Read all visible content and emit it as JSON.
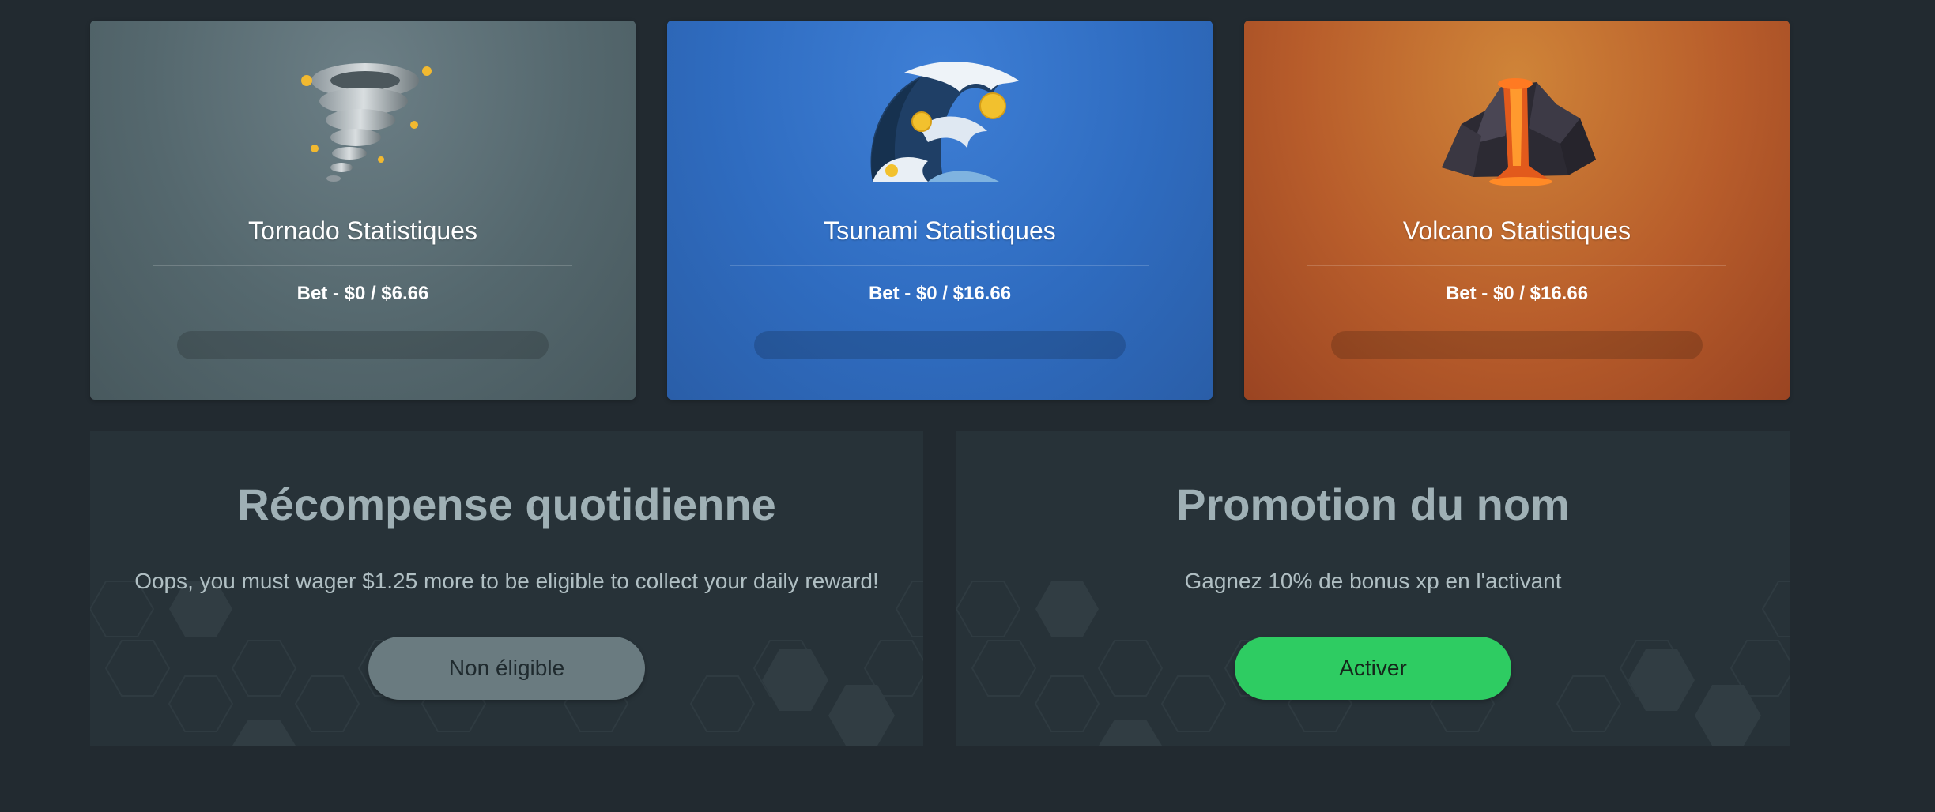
{
  "stat_cards": [
    {
      "id": "tornado",
      "title": "Tornado Statistiques",
      "bet": "Bet - $0 / $6.66",
      "progress": 0
    },
    {
      "id": "tsunami",
      "title": "Tsunami Statistiques",
      "bet": "Bet - $0 / $16.66",
      "progress": 0
    },
    {
      "id": "volcano",
      "title": "Volcano Statistiques",
      "bet": "Bet - $0 / $16.66",
      "progress": 0
    }
  ],
  "daily_reward": {
    "title": "Récompense quotidienne",
    "message": "Oops, you must wager $1.25 more to be eligible to collect your daily reward!",
    "button_label": "Non éligible"
  },
  "name_promotion": {
    "title": "Promotion du nom",
    "message": "Gagnez 10% de bonus xp en l'activant",
    "button_label": "Activer"
  },
  "colors": {
    "background": "#222a30",
    "panel": "#273238",
    "accent_green": "#2ecc62",
    "tornado_card": "#5d7077",
    "tsunami_card": "#2f6cc0",
    "volcano_card": "#b85d2b"
  }
}
